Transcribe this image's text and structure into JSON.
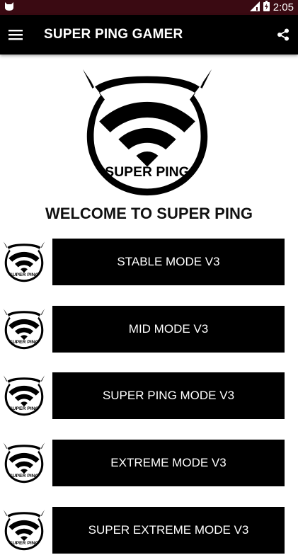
{
  "status_bar": {
    "time": "2:05"
  },
  "app_bar": {
    "title": "SUPER PING GAMER"
  },
  "logo": {
    "text": "SUPER PING"
  },
  "welcome": "WELCOME TO SUPER PING",
  "modes": [
    {
      "label": "STABLE MODE V3",
      "logo_text": "SUPER PING"
    },
    {
      "label": "MID MODE V3",
      "logo_text": "SUPER PING"
    },
    {
      "label": "SUPER PING MODE V3",
      "logo_text": "SUPER PING"
    },
    {
      "label": "EXTREME MODE V3",
      "logo_text": "SUPER PING"
    },
    {
      "label": "SUPER EXTREME MODE V3",
      "logo_text": "SUPER PING"
    }
  ],
  "colors": {
    "status_bar": "#3a0a12",
    "app_bar": "#000000",
    "button": "#000000",
    "button_text": "#ffffff"
  }
}
